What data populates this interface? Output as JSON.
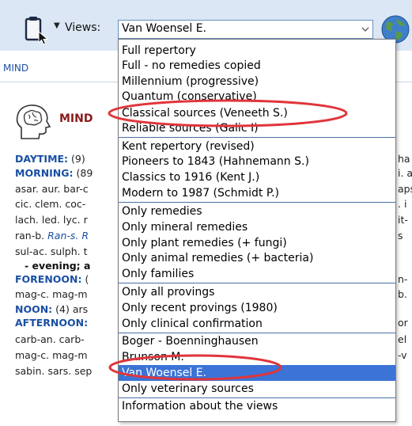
{
  "toolbar": {
    "views_label": "Views:",
    "views_value": "Van Woensel E."
  },
  "tab": {
    "label": "MIND"
  },
  "chapter": {
    "title": "MIND"
  },
  "views": {
    "options": [
      "Full repertory",
      "Full - no remedies copied",
      "Millennium (progressive)",
      "Quantum (conservative)",
      "Classical sources (Veneeth S.)",
      "Reliable sources (Galic I)",
      "Kent repertory (revised)",
      "Pioneers to 1843 (Hahnemann S.)",
      "Classics to 1916 (Kent J.)",
      "Modern to 1987 (Schmidt P.)",
      "Only remedies",
      "Only mineral remedies",
      "Only plant remedies (+ fungi)",
      "Only animal remedies (+ bacteria)",
      "Only families",
      "Only all provings",
      "Only recent provings (1980)",
      "Only clinical confirmation",
      "Boger - Boenninghausen",
      "Brunson M.",
      "Van Woensel E.",
      "Only veterinary sources",
      "Information about the views"
    ],
    "selected": "Van Woensel E."
  },
  "repertory": {
    "daytime": "DAYTIME:",
    "daytime_count": "(9)",
    "morning": "MORNING:",
    "morning_count": "(89",
    "line3": "asar. aur. bar-c",
    "line4": "cic. clem. coc-",
    "line5": "lach. led. lyc. r",
    "line6a": "ran-b.",
    "line6b": "Ran-s. R",
    "line7": "sul-ac. sulph. t",
    "evening": "- evening; a",
    "forenoon": "FORENOON:",
    "forenoon_count": "(",
    "line10": "mag-c. mag-m",
    "noon": "NOON:",
    "noon_count": "(4) ars",
    "afternoon": "AFTERNOON:",
    "line13": "carb-an. carb-",
    "line14": "mag-c. mag-m",
    "line15": "sabin. sars. sep"
  },
  "right_fragments": [
    "ha",
    "i. a",
    "aps",
    ". i",
    "it-",
    "s",
    "n-",
    "b.",
    "or",
    "el",
    "-v"
  ]
}
